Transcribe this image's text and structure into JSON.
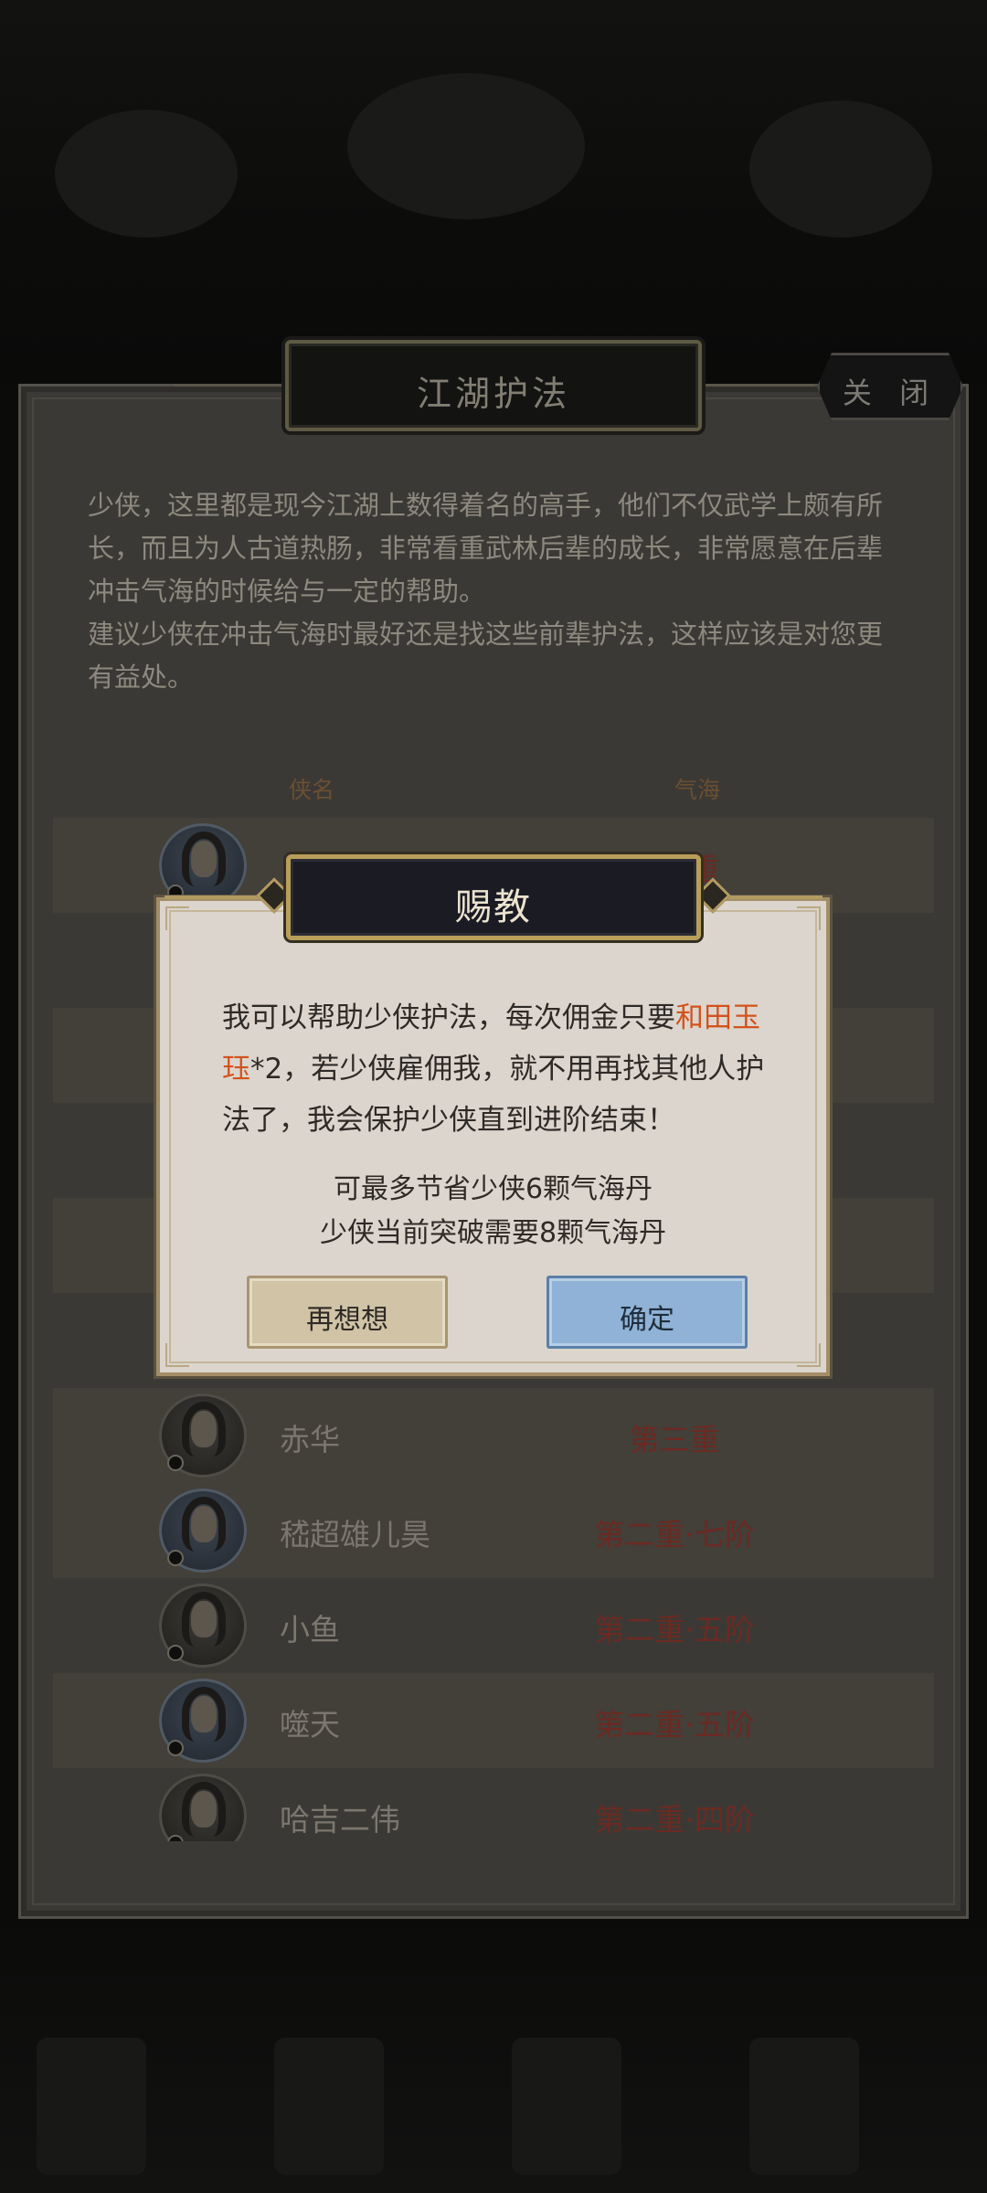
{
  "panel": {
    "title": "江湖护法",
    "close_label": "关 闭",
    "description": [
      "少侠，这里都是现今江湖上数得着名的高手，他们不仅武学上颇有所长，而且为人古道热肠，非常看重武林后辈的成长，非常愿意在后辈冲击气海的时候给与一定的帮助。",
      "建议少侠在冲击气海时最好还是找这些前辈护法，这样应该是对您更有益处。"
    ],
    "columns": {
      "name": "侠名",
      "level": "气海"
    }
  },
  "protectors": [
    {
      "name": "",
      "level": "第三重",
      "avatar": "blue"
    },
    {
      "name": "赤华",
      "level": "第三重",
      "avatar": "dark"
    },
    {
      "name": "嵇超雄儿昊",
      "level": "第二重·七阶",
      "avatar": "blue"
    },
    {
      "name": "小鱼",
      "level": "第二重·五阶",
      "avatar": "dark"
    },
    {
      "name": "噬天",
      "level": "第二重·五阶",
      "avatar": "blue"
    },
    {
      "name": "哈吉二伟",
      "level": "第二重·四阶",
      "avatar": "dark"
    }
  ],
  "dialog": {
    "title": "赐教",
    "message_before": "我可以帮助少侠护法，每次佣金只要",
    "message_highlight": "和田玉珏",
    "message_after": "*2，若少侠雇佣我，就不用再找其他人护法了，我会保护少侠直到进阶结束！",
    "note_save": "可最多节省少侠6颗气海丹",
    "note_need": "少侠当前突破需要8颗气海丹",
    "cancel_label": "再想想",
    "confirm_label": "确定"
  },
  "colors": {
    "highlight": "#d3521c",
    "level_red": "#6b2a22",
    "confirm_button": "#8fb2d6",
    "cancel_button": "#d0c3a6"
  }
}
